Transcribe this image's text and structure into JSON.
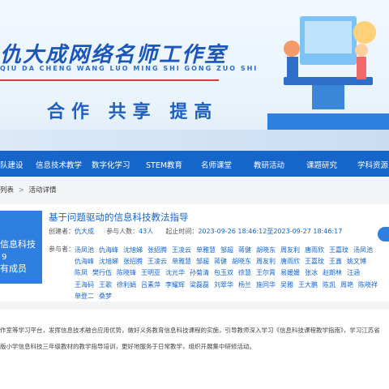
{
  "banner": {
    "title": "仇大成网络名师工作室",
    "pinyin": "QIU DA CHENG WANG LUO MING SHI GONG ZUO SHI",
    "slogan": "合作  共享  提高"
  },
  "nav": {
    "items": [
      "队建设",
      "信息技术教学",
      "数字化学习",
      "STEM教育",
      "名师课堂",
      "教研活动",
      "课题研究",
      "学科资源"
    ]
  },
  "breadcrumb": {
    "parent": "列表",
    "separator": ">",
    "current": "活动详情"
  },
  "tile": {
    "line1": "信息科技",
    "line2": "9",
    "line3": "有成员"
  },
  "activity": {
    "title": "基于问题驱动的信息科技教法指导",
    "creator_label": "创建者：",
    "creator": "仇大成",
    "count_label": "参与人数：",
    "count": "43人",
    "time_label": "起止时间：",
    "time": "2023-09-26 18:46:12至2023-09-27 18:46:17",
    "participants_label": "参与者：",
    "participants": [
      "汤凤池",
      "仇海峰",
      "沈旭娣",
      "张招腾",
      "王凌云",
      "单雅慧",
      "邹超",
      "蒋健",
      "胡晓东",
      "周友利",
      "唐雨欣",
      "王嘉玟",
      "汤凤池",
      "仇海峰",
      "沈旭娣",
      "张招腾",
      "王凌云",
      "单雅慧",
      "邹超",
      "蒋健",
      "胡晓东",
      "周友利",
      "唐雨欣",
      "王嘉玟",
      "王鑫",
      "姚文博",
      "陈凤",
      "樊行伍",
      "陈晓锋",
      "王明亚",
      "沈光华",
      "孙菊清",
      "包玉双",
      "徐慧",
      "王尔霄",
      "易媛媛",
      "张冰",
      "赵朗林",
      "汪涵",
      "王海码",
      "王歌",
      "徐利娟",
      "吕素萍",
      "李耀辉",
      "梁磊磊",
      "刘翠华",
      "杨兰",
      "施同华",
      "吴雅",
      "王大鹏",
      "陈凯",
      "周艳",
      "陈晓祥",
      "单登二",
      "桑梦"
    ]
  },
  "description": {
    "line1": "作室等学习平台，发挥信息技术融合应用优势，做好义务教育信息科技课程的实施，引导教师深入学习《信息科技课程教学指南》，学习江苏省",
    "line2": "版小学信息科技三年级教材的教学指导培训，更好地服务于日常教学，组织开展集中研修活动。"
  },
  "colors": {
    "nav": "#1665c9",
    "accent": "#2f7fe0",
    "title_blue": "#1b56b8"
  }
}
